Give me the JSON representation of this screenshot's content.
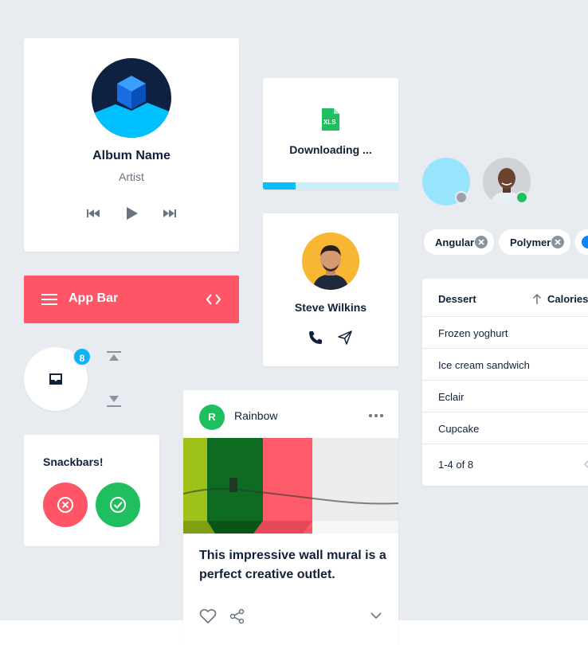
{
  "album": {
    "name": "Album Name",
    "artist": "Artist"
  },
  "appbar": {
    "title": "App Bar"
  },
  "fab": {
    "badge": "8"
  },
  "snackbar": {
    "title": "Snackbars!"
  },
  "download": {
    "label": "Downloading ...",
    "file_icon_text": "XLS",
    "progress": 0.24
  },
  "contact": {
    "name": "Steve Wilkins"
  },
  "post": {
    "avatar_letter": "R",
    "user": "Rainbow",
    "text": "This impressive wall mural is a perfect creative outlet."
  },
  "chips": [
    {
      "label": "Angular"
    },
    {
      "label": "Polymer"
    }
  ],
  "table": {
    "headers": {
      "dessert": "Dessert",
      "calories": "Calories"
    },
    "rows": [
      "Frozen yoghurt",
      "Ice cream sandwich",
      "Eclair",
      "Cupcake"
    ],
    "footer": "1-4 of 8"
  },
  "colors": {
    "accent_red": "#ff5566",
    "accent_blue": "#0bbcf7",
    "accent_green": "#1fbf5f",
    "background": "#e8ebef",
    "text_dark": "#12213a"
  }
}
